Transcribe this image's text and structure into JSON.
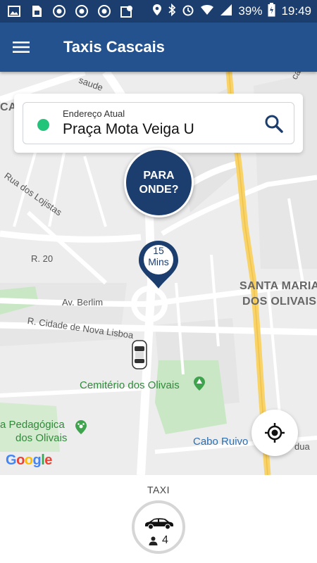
{
  "status_bar": {
    "battery": "39%",
    "time": "19:49",
    "icons_left": [
      "image-icon",
      "sim-card-icon",
      "chrome-icon",
      "chrome-icon",
      "chrome-icon",
      "map-pin-icon"
    ],
    "icons_right": [
      "location-icon",
      "bluetooth-icon",
      "alarm-icon",
      "wifi-icon",
      "signal-icon",
      "battery-charging-icon"
    ]
  },
  "app_bar": {
    "title": "Taxis Cascais",
    "menu_icon": "hamburger-menu-icon"
  },
  "address": {
    "label": "Endereço Atual",
    "value": "Praça Mota Veiga U",
    "search_icon": "search-icon"
  },
  "destination_button": {
    "line1": "PARA",
    "line2": "ONDE?"
  },
  "pickup_pin": {
    "minutes": "15",
    "unit": "Mins"
  },
  "map_labels": {
    "av_berlim": "Av. Berlim",
    "r_cidade": "R. Cidade de Nova Lisboa",
    "r20": "R. 20",
    "rua_lojistas": "Rua dos Lojistas",
    "cemiterio": "Cemitério dos Olivais",
    "santa_maria_1": "SANTA MARIA",
    "santa_maria_2": "DOS OLIVAIS",
    "cabo_ruivo": "Cabo Ruivo",
    "quinta_1": "a Pedagógica",
    "quinta_2": "dos Olivais",
    "cai": "CAI",
    "saude": "saude",
    "cavede": "cavede",
    "rua_partial": "dua"
  },
  "google_logo": {
    "letters": [
      "G",
      "o",
      "o",
      "g",
      "l",
      "e"
    ],
    "colors": [
      "#4285f4",
      "#ea4335",
      "#fbbc05",
      "#4285f4",
      "#34a853",
      "#ea4335"
    ]
  },
  "bottom_panel": {
    "category_label": "TAXI",
    "seats": "4"
  },
  "colors": {
    "primary_dark": "#1c3e6e",
    "primary": "#23528e",
    "current_location_dot": "#22c47a"
  }
}
